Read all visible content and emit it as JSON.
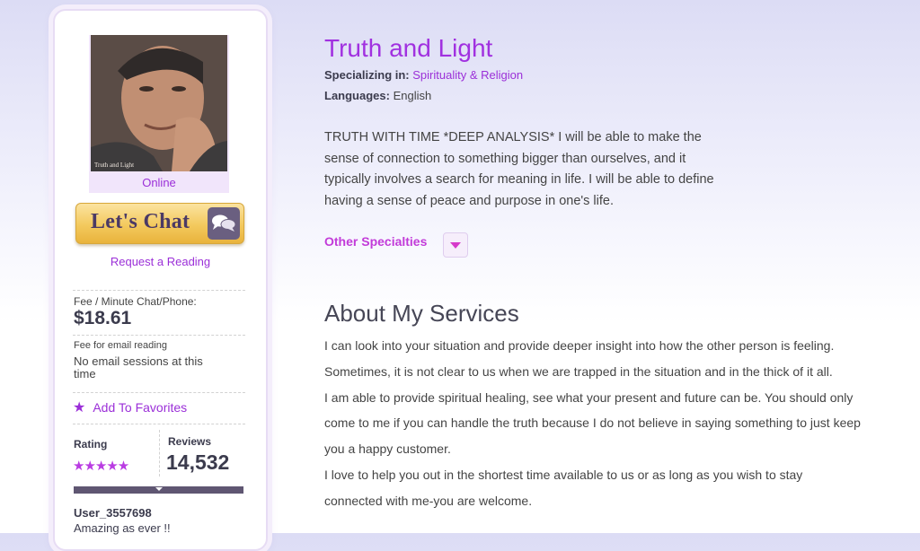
{
  "advisor": {
    "status": "Online",
    "photo_caption": "Truth and Light",
    "chat_label": "Let's Chat",
    "request_label": "Request a Reading",
    "fee_label": "Fee / Minute Chat/Phone:",
    "fee_value": "$18.61",
    "email_fee_label": "Fee for email reading",
    "email_fee_value": "No email sessions at this time",
    "favorites_label": "Add To Favorites",
    "rating_label": "Rating",
    "stars": "★★★★★",
    "rating_stars": 5,
    "reviews_label": "Reviews",
    "reviews_count": "14,532",
    "latest_review": {
      "user": "User_3557698",
      "text": "Amazing as ever !!"
    }
  },
  "profile": {
    "name": "Truth and Light",
    "specializing_label": "Specializing in:",
    "specializing_value": "Spirituality & Religion",
    "languages_label": "Languages:",
    "languages_value": "English",
    "description": "TRUTH WITH TIME *DEEP ANALYSIS* I will be able to make the sense of connection to something bigger than ourselves, and it typically involves a search for meaning in life. I will be able to define having a sense of peace and purpose in one's life.",
    "other_specialties_label": "Other Specialties"
  },
  "about": {
    "title": "About My Services",
    "paragraphs": [
      "I can look into your situation and provide deeper insight into how the other person is feeling. Sometimes, it is not clear to us when we are trapped in the situation and in the thick of it all.",
      "I am able to provide spiritual healing, see what your present and future can be. You should only come to me if you can handle the truth because I do not believe in saying something to just keep you a happy customer.",
      "I love to help you out in the shortest time available to us or as long as you wish to stay connected with me-you are welcome."
    ]
  },
  "colors": {
    "accent": "#9b2fd8",
    "chat_button": "#f3c95d",
    "dark": "#3b3b4d"
  },
  "icons": [
    "chat-bubbles-icon",
    "star-icon",
    "chevron-down-icon"
  ]
}
